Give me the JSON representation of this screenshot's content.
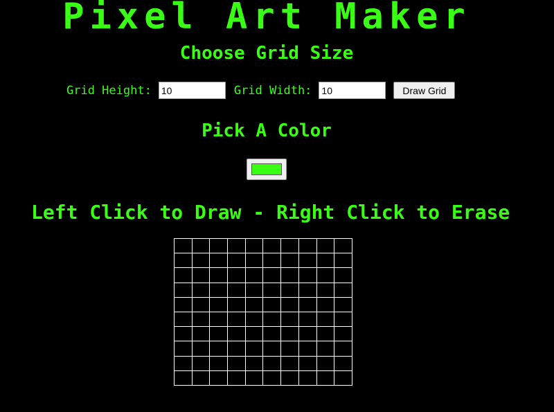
{
  "page": {
    "title": "Pixel Art Maker",
    "choose_heading": "Choose Grid Size",
    "pick_heading": "Pick A Color",
    "instructions_heading": "Left Click to Draw - Right Click to Erase"
  },
  "size_form": {
    "height_label": "Grid Height:",
    "height_value": "10",
    "width_label": "Grid Width:",
    "width_value": "10",
    "submit_label": "Draw Grid"
  },
  "color_picker": {
    "value": "#39ff14"
  },
  "grid": {
    "rows": 10,
    "cols": 10
  },
  "colors": {
    "accent": "#39ff14",
    "background": "#000000",
    "grid_line": "#ffffff"
  }
}
